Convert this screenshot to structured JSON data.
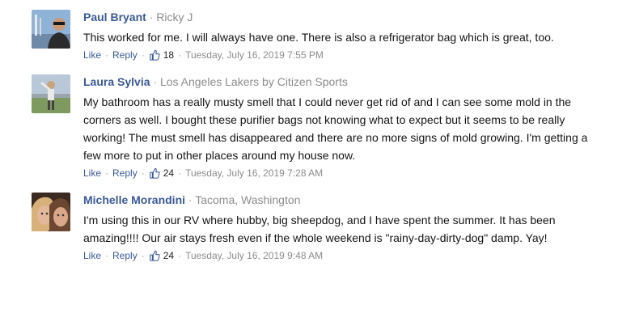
{
  "comments": [
    {
      "author": "Paul Bryant",
      "location": "Ricky J",
      "text": "This worked for me. I will always have one. There is also a refrigerator bag which is great, too.",
      "like_label": "Like",
      "reply_label": "Reply",
      "likes": "18",
      "date": "Tuesday, July 16, 2019 7:55 PM"
    },
    {
      "author": "Laura Sylvia",
      "location": "Los Angeles Lakers by Citizen Sports",
      "text": "My bathroom has a really musty smell that I could never get rid of and I can see some mold in the corners as well. I bought these purifier bags not knowing what to expect but it seems to be really working! The must smell has disappeared and there are no more signs of mold growing. I'm getting a few more to put in other places around my house now.",
      "like_label": "Like",
      "reply_label": "Reply",
      "likes": "24",
      "date": "Tuesday, July 16, 2019 7:28 AM"
    },
    {
      "author": "Michelle Morandini",
      "location": "Tacoma, Washington",
      "text": "I'm using this in our RV where hubby, big sheepdog, and I have spent the summer. It has been amazing!!!! Our air stays fresh even if the whole weekend is \"rainy-day-dirty-dog\" damp. Yay!",
      "like_label": "Like",
      "reply_label": "Reply",
      "likes": "24",
      "date": "Tuesday, July 16, 2019 9:48 AM"
    }
  ],
  "separator": "·",
  "colors": {
    "author_link": "#3b5998",
    "meta_gray": "#8c8c8c",
    "body_text": "#141414"
  },
  "icons": {
    "like": "thumbs-up-icon"
  }
}
